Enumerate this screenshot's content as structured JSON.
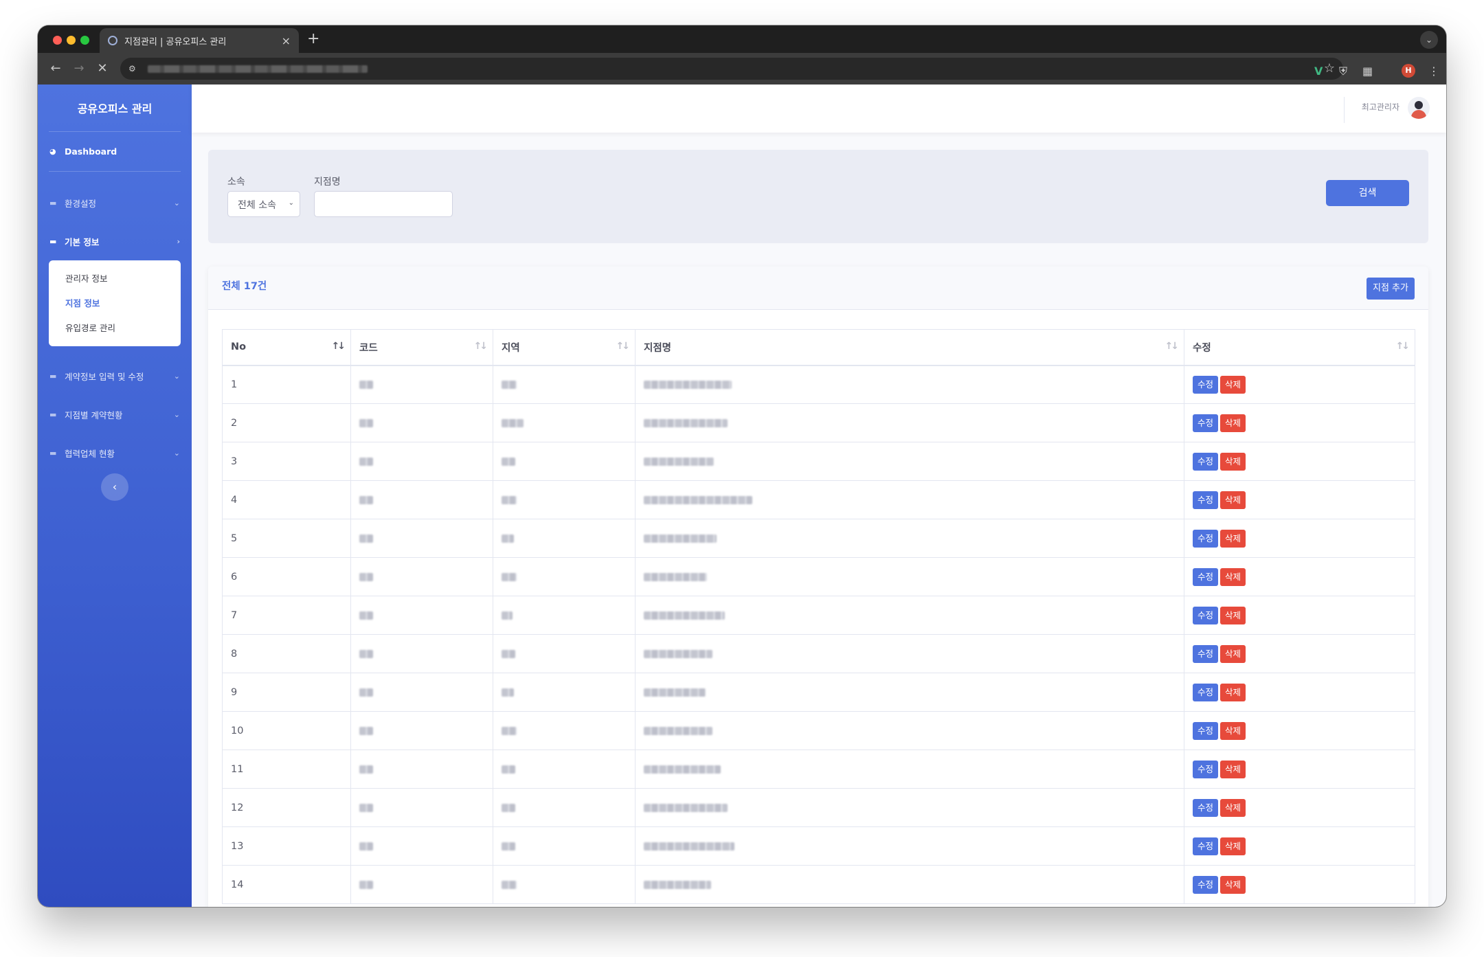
{
  "browser": {
    "tab_title": "지점관리 | 공유오피스 관리",
    "new_tab": "+",
    "close": "×",
    "profile_initial": "H"
  },
  "sidebar": {
    "brand": "공유오피스 관리",
    "dashboard": "Dashboard",
    "menu": [
      {
        "label": "환경설정",
        "expanded": false
      },
      {
        "label": "기본 정보",
        "expanded": true
      },
      {
        "label": "계약정보 입력 및 수정",
        "expanded": false
      },
      {
        "label": "지점별 계약현황",
        "expanded": false
      },
      {
        "label": "협력업체 현황",
        "expanded": false
      }
    ],
    "submenu": [
      {
        "label": "관리자 정보",
        "active": false
      },
      {
        "label": "지점 정보",
        "active": true
      },
      {
        "label": "유입경로 관리",
        "active": false
      }
    ]
  },
  "topbar": {
    "user_name": "최고관리자"
  },
  "search": {
    "affiliation_label": "소속",
    "affiliation_value": "전체 소속",
    "branch_label": "지점명",
    "branch_value": "",
    "button": "검색"
  },
  "list": {
    "total": "전체 17건",
    "add_button": "지점 추가",
    "columns": [
      "No",
      "코드",
      "지역",
      "지점명",
      "수정"
    ],
    "edit_label": "수정",
    "delete_label": "삭제",
    "rows": [
      {
        "no": "1"
      },
      {
        "no": "2"
      },
      {
        "no": "3"
      },
      {
        "no": "4"
      },
      {
        "no": "5"
      },
      {
        "no": "6"
      },
      {
        "no": "7"
      },
      {
        "no": "8"
      },
      {
        "no": "9"
      },
      {
        "no": "10"
      },
      {
        "no": "11"
      },
      {
        "no": "12"
      },
      {
        "no": "13"
      },
      {
        "no": "14"
      }
    ]
  },
  "colors": {
    "primary": "#4e73df",
    "danger": "#e74a3b",
    "page_bg": "#f8f9fc"
  }
}
